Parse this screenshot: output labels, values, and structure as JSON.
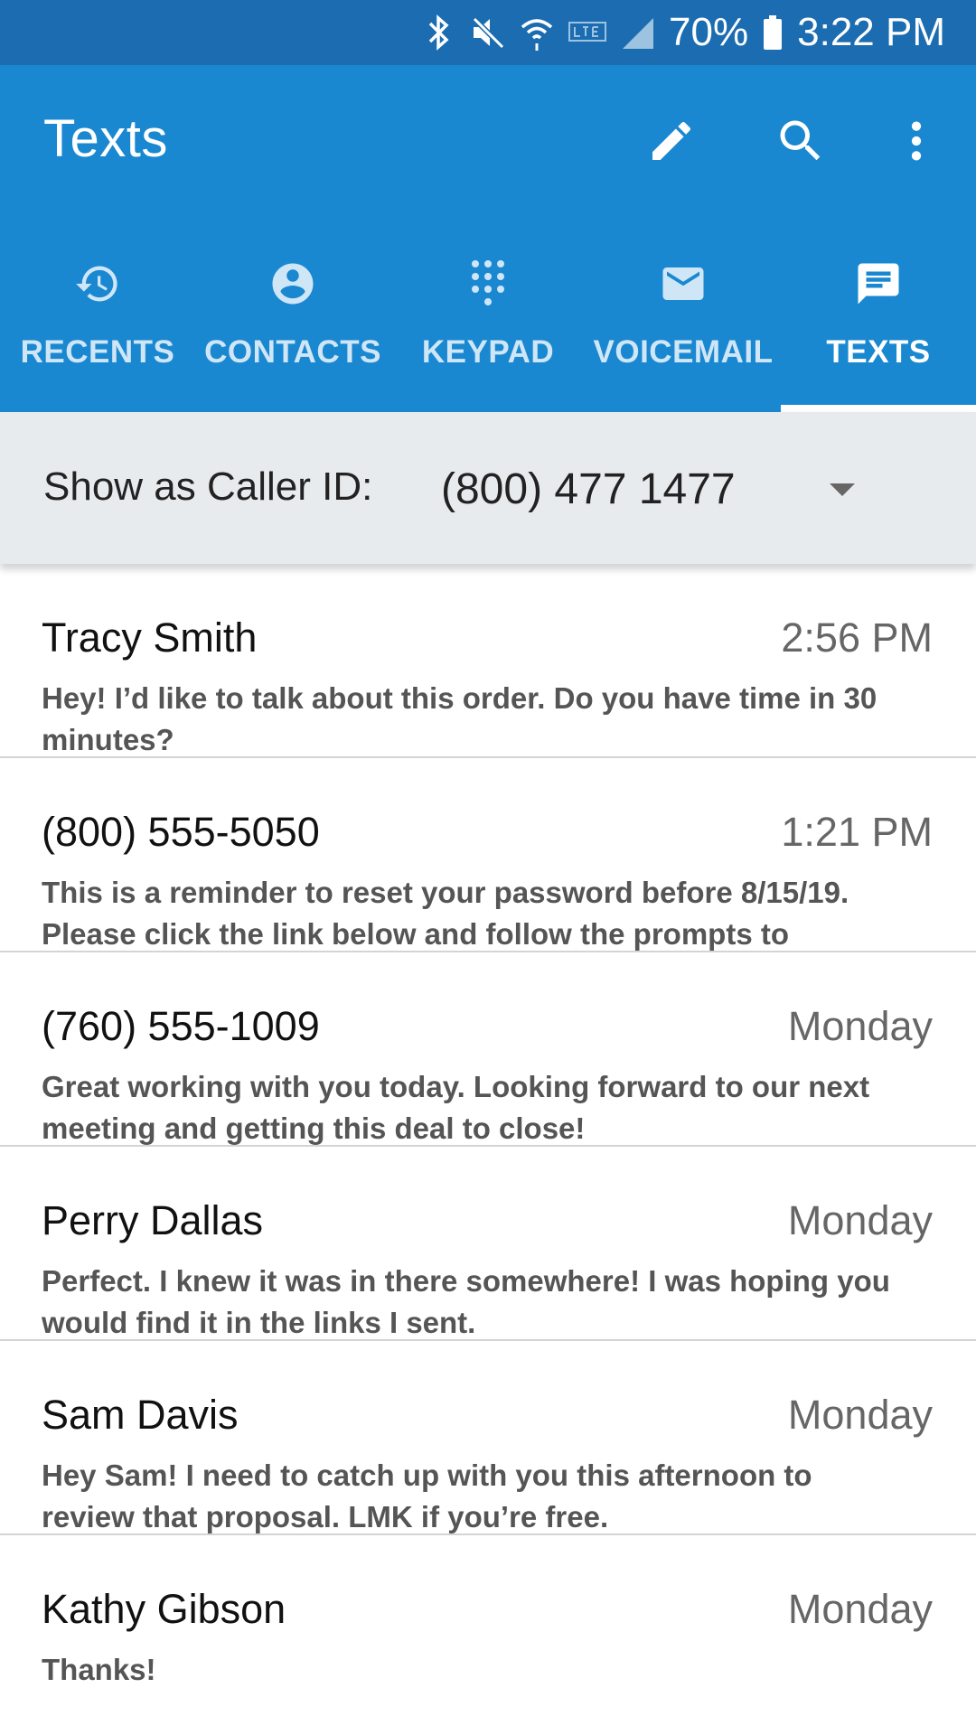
{
  "status_bar": {
    "battery": "70%",
    "time": "3:22 PM",
    "icons": [
      "bluetooth-icon",
      "mute-icon",
      "wifi-icon",
      "lte-icon",
      "signal-icon",
      "battery-icon"
    ]
  },
  "app_bar": {
    "title": "Texts",
    "actions": [
      "compose-icon",
      "search-icon",
      "more-vert-icon"
    ]
  },
  "tabs": [
    {
      "label": "RECENTS",
      "icon": "history-icon",
      "active": false
    },
    {
      "label": "CONTACTS",
      "icon": "account-circle-icon",
      "active": false
    },
    {
      "label": "KEYPAD",
      "icon": "dialpad-icon",
      "active": false
    },
    {
      "label": "VOICEMAIL",
      "icon": "mail-icon",
      "active": false
    },
    {
      "label": "TEXTS",
      "icon": "chat-icon",
      "active": true
    }
  ],
  "caller_id": {
    "label": "Show as Caller ID:",
    "value": "(800) 477 1477"
  },
  "threads": [
    {
      "name": "Tracy Smith",
      "time": "2:56 PM",
      "preview": "Hey! I’d like to talk about this order. Do you have time in 30 minutes?"
    },
    {
      "name": "(800) 555-5050",
      "time": "1:21 PM",
      "preview": "This is a reminder to reset your password before 8/15/19. Please click the link below and follow the prompts to"
    },
    {
      "name": "(760) 555-1009",
      "time": "Monday",
      "preview": "Great working with you today. Looking forward to our next meeting and getting this deal to close!"
    },
    {
      "name": "Perry Dallas",
      "time": "Monday",
      "preview": "Perfect. I knew it was in there somewhere! I was hoping you would find it in the links I sent."
    },
    {
      "name": "Sam Davis",
      "time": "Monday",
      "preview": "Hey Sam! I need to catch up with you this afternoon to review that proposal. LMK if you’re free."
    },
    {
      "name": "Kathy Gibson",
      "time": "Monday",
      "preview": "Thanks!"
    }
  ],
  "colors": {
    "status_bar": "#1b6cb0",
    "app_bar": "#1a88d0",
    "caller_bar": "#e8ebee",
    "divider": "#d4d4d4"
  }
}
